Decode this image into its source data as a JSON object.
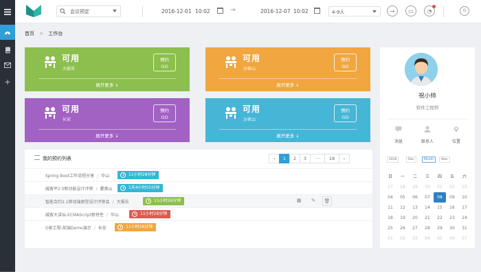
{
  "header": {
    "search_value": "会议预定",
    "start_date": "2016-12-01",
    "start_time": "10:02",
    "end_date": "2016-12-07",
    "end_time": "10:02",
    "people_value": "4-9人"
  },
  "breadcrumb": {
    "home": "首页",
    "separator": ">",
    "current": "工作台"
  },
  "tiles": [
    {
      "status": "可用",
      "location": "大报告",
      "go": [
        "预约",
        "GO"
      ],
      "more": "展开更多 ↓",
      "color": "#8cbf4e"
    },
    {
      "status": "可用",
      "location": "沙家山",
      "go": [
        "预约",
        "GO"
      ],
      "more": "展开更多 ↓",
      "color": "#f1a63f"
    },
    {
      "status": "可用",
      "location": "长安",
      "go": [
        "预约",
        "GO"
      ],
      "more": "展开更多 ↓",
      "color": "#a262c4"
    },
    {
      "status": "可用",
      "location": "沙家山",
      "go": [
        "预约",
        "GO"
      ],
      "more": "展开更多 ↓",
      "color": "#46b6d6"
    }
  ],
  "profile": {
    "name": "祝小帅",
    "title": "软件工程师",
    "stats": [
      "消息",
      "联系人",
      "位置"
    ]
  },
  "list": {
    "title": "我的预约列表",
    "pages": [
      "‹",
      "1",
      "2",
      "3",
      "···",
      "18",
      "›"
    ],
    "rows": [
      {
        "topic": "Spring Boot工作流程分享",
        "room": "华山",
        "time": "11小时28分钟",
        "color": "#32b7d4"
      },
      {
        "topic": "威客平2.0新功能设计评审",
        "room": "蒙奥山",
        "time": "1天4小时55分钟",
        "color": "#32b7d4"
      },
      {
        "topic": "智能合约2.1移动端原型设计评审会",
        "room": "大报告",
        "time": "11小时26分钟",
        "color": "#8cbf4e"
      },
      {
        "topic": "威客大讲坛-ECMAScript新特性",
        "room": "华山",
        "time": "11小时28分钟",
        "color": "#e05a4e"
      },
      {
        "topic": "O家工程-前端Demo演示",
        "room": "长安",
        "time": "11小时26分钟",
        "color": "#f1a63f"
      }
    ]
  },
  "calendar": {
    "selects": [
      "2016",
      "Dec",
      "Month",
      "Year"
    ],
    "weekdays": [
      "日",
      "一",
      "二",
      "三",
      "四",
      "五",
      "六"
    ],
    "weeks": [
      [
        "27",
        "28",
        "29",
        "30",
        "01",
        "02",
        "03"
      ],
      [
        "04",
        "05",
        "06",
        "07",
        "08",
        "09",
        "10"
      ],
      [
        "11",
        "12",
        "13",
        "14",
        "15",
        "16",
        "17"
      ],
      [
        "18",
        "19",
        "20",
        "21",
        "22",
        "23",
        "24"
      ],
      [
        "25",
        "26",
        "27",
        "28",
        "29",
        "30",
        "31"
      ],
      [
        "01",
        "02",
        "03",
        "04",
        "05",
        "06",
        "07"
      ]
    ],
    "selected": "08"
  }
}
